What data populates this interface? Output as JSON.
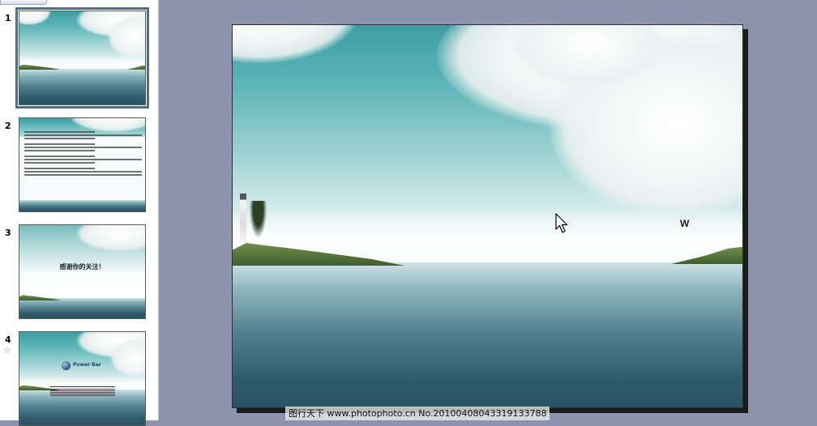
{
  "thumbnail_pane": {
    "slides": [
      {
        "number": "1",
        "selected": true
      },
      {
        "number": "2",
        "selected": false
      },
      {
        "number": "3",
        "selected": false,
        "title": "感谢你的关注！"
      },
      {
        "number": "4",
        "selected": false,
        "brand": "Power Bar"
      }
    ]
  },
  "main_slide": {
    "letter": "W"
  },
  "watermark": {
    "text": "图行天下 www.photophoto.cn  No.20100408043319133788"
  },
  "colors": {
    "workspace_bg": "#8d93ad",
    "selection_outline": "#4d6f8c",
    "sky_top": "#3e9ea3",
    "sea_deep": "#2a5363"
  },
  "icons": {
    "pointer": "cursor-arrow-icon",
    "slide4_marker": "star-icon"
  }
}
